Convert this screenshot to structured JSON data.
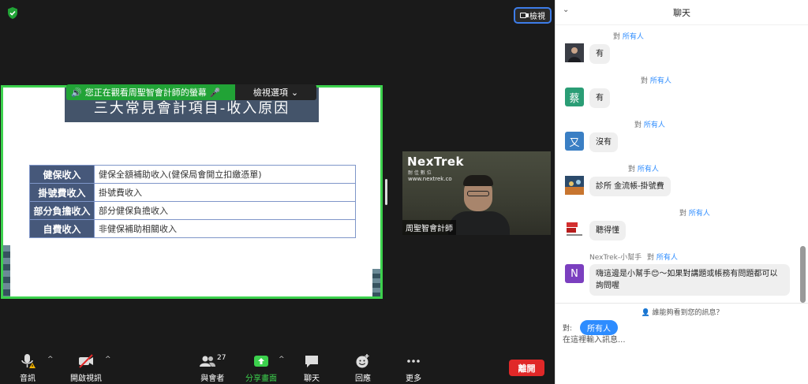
{
  "meeting": {
    "view_button_label": "檢視",
    "share_notice": "您正在觀看周聖智會計師的螢幕",
    "view_options_label": "檢視選項"
  },
  "slide": {
    "title": "三大常見會計項目-收入原因",
    "rows": [
      {
        "key": "健保收入",
        "value": "健保全額補助收入(健保局會開立扣繳憑單)"
      },
      {
        "key": "掛號費收入",
        "value": "掛號費收入"
      },
      {
        "key": "部分負擔收入",
        "value": "部分健保負擔收入"
      },
      {
        "key": "自費收入",
        "value": "非健保補助相關收入"
      }
    ]
  },
  "video": {
    "logo_text": "NexTrek",
    "logo_sub": "耐 佳 數 位",
    "url": "www.nextrek.co",
    "participant_name": "周聖智會計師"
  },
  "toolbar": {
    "audio": "音訊",
    "video": "開啟視訊",
    "participants": "與會者",
    "participant_count": "27",
    "share": "分享畫面",
    "chat": "聊天",
    "reactions": "回應",
    "more": "更多",
    "leave": "離開"
  },
  "chat": {
    "title": "聊天",
    "to_prefix": "對",
    "everyone": "所有人",
    "messages": [
      {
        "sender": "",
        "avatar_letter": "",
        "text": "有"
      },
      {
        "sender": "",
        "avatar_letter": "蔡",
        "text": "有"
      },
      {
        "sender": "",
        "avatar_letter": "又",
        "text": "沒有"
      },
      {
        "sender": "",
        "avatar_letter": "",
        "text": "診所 金流帳-掛號費"
      },
      {
        "sender": "",
        "avatar_letter": "",
        "text": "聽得懂"
      },
      {
        "sender": "NexTrek-小幫手",
        "avatar_letter": "N",
        "text": "嗨這邊是小幫手😊～如果對講題或帳務有問題都可以詢問喔"
      }
    ],
    "who_can_see": "誰能夠看到您的訊息？",
    "to_label": "對:",
    "input_placeholder": "在這裡輸入訊息..."
  },
  "colors": {
    "share_border": "#3cd14d",
    "accent_blue": "#2d8cff",
    "leave_red": "#e02828",
    "slide_header": "#46587a"
  }
}
